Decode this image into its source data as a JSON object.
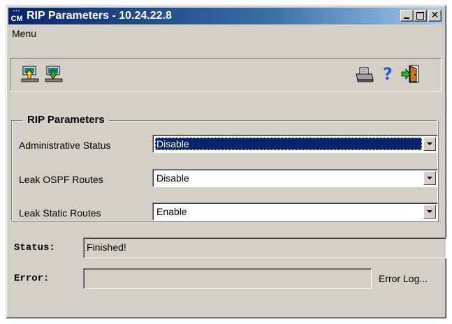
{
  "window": {
    "title": "RIP Parameters - 10.24.22.8",
    "icon_label": "CM"
  },
  "menubar": {
    "items": [
      "Menu"
    ]
  },
  "toolbar": {
    "buttons": [
      {
        "name": "upload",
        "icon": "upload-icon"
      },
      {
        "name": "download",
        "icon": "download-icon"
      },
      {
        "name": "print",
        "icon": "printer-icon"
      },
      {
        "name": "help",
        "icon": "help-icon"
      },
      {
        "name": "exit",
        "icon": "exit-door-icon"
      }
    ]
  },
  "rip": {
    "group_title": "RIP Parameters",
    "params": [
      {
        "label": "Administrative Status",
        "value": "Disable"
      },
      {
        "label": "Leak OSPF Routes",
        "value": "Disable"
      },
      {
        "label": "Leak Static Routes",
        "value": "Enable"
      }
    ]
  },
  "status": {
    "label": "Status:",
    "value": "Finished!"
  },
  "error": {
    "label": "Error:",
    "value": "",
    "log_link": "Error Log..."
  },
  "colors": {
    "title_bar": "#0a246a",
    "window_bg": "#d4d0c8",
    "selection": "#0a246a"
  }
}
